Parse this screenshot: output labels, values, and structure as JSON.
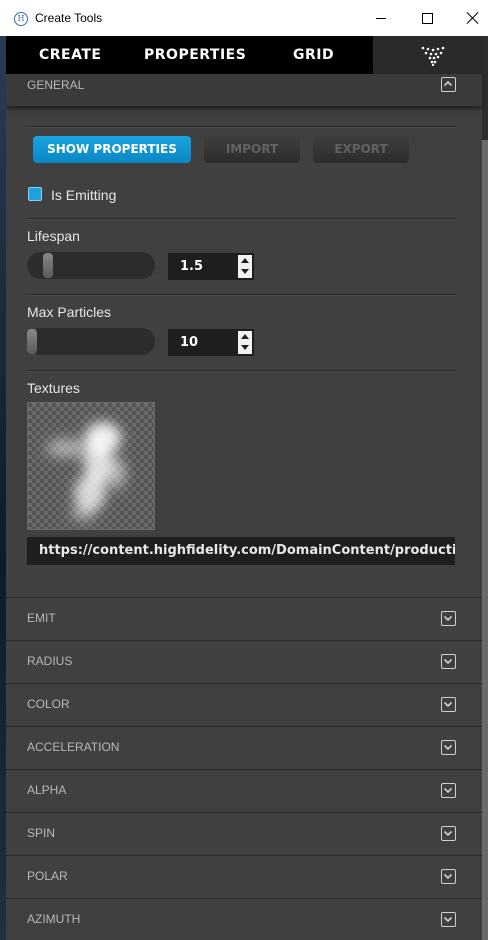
{
  "window": {
    "title": "Create Tools",
    "icon": "hifi-logo-icon"
  },
  "nav": {
    "tabs": [
      "CREATE",
      "PROPERTIES",
      "GRID"
    ],
    "logo_icon": "particles-logo-icon"
  },
  "general": {
    "title": "GENERAL",
    "buttons": {
      "show_properties": "SHOW PROPERTIES",
      "import": "IMPORT",
      "export": "EXPORT"
    },
    "is_emitting": {
      "label": "Is Emitting",
      "checked": true
    },
    "lifespan": {
      "label": "Lifespan",
      "value": "1.5",
      "slider_fraction": 0.1
    },
    "max_particles": {
      "label": "Max Particles",
      "value": "10",
      "slider_fraction": 0.0
    },
    "textures": {
      "label": "Textures",
      "url": "https://content.highfidelity.com/DomainContent/productio"
    }
  },
  "sections": [
    "EMIT",
    "RADIUS",
    "COLOR",
    "ACCELERATION",
    "ALPHA",
    "SPIN",
    "POLAR",
    "AZIMUTH"
  ],
  "colors": {
    "accent": "#0e93d2",
    "panel": "#404040",
    "nav": "#000000"
  }
}
